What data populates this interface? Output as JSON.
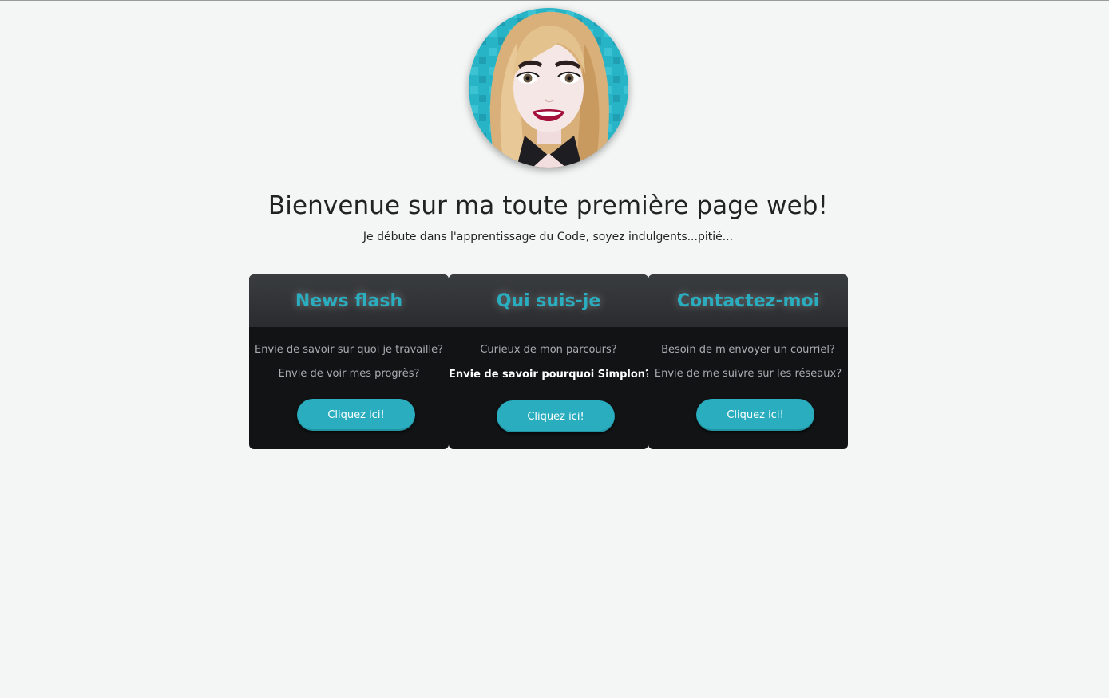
{
  "page": {
    "title": "Bienvenue sur ma toute première page web!",
    "subtitle": "Je débute dans l'apprentissage du Code, soyez indulgents...pitié..."
  },
  "colors": {
    "accent": "#2aaebf",
    "card_bg": "#111315",
    "page_bg": "#f4f6f5"
  },
  "cards": [
    {
      "title": "News flash",
      "line1": "Envie de savoir sur quoi je travaille?",
      "line2": "Envie de voir mes progrès?",
      "button": "Cliquez ici!"
    },
    {
      "title": "Qui suis-je",
      "line1": "Curieux de mon parcours?",
      "line2": "Envie de savoir pourquoi Simplon?",
      "button": "Cliquez ici!"
    },
    {
      "title": "Contactez-moi",
      "line1": "Besoin de m'envoyer un courriel?",
      "line2": "Envie de me suivre sur les réseaux?",
      "button": "Cliquez ici!"
    }
  ]
}
